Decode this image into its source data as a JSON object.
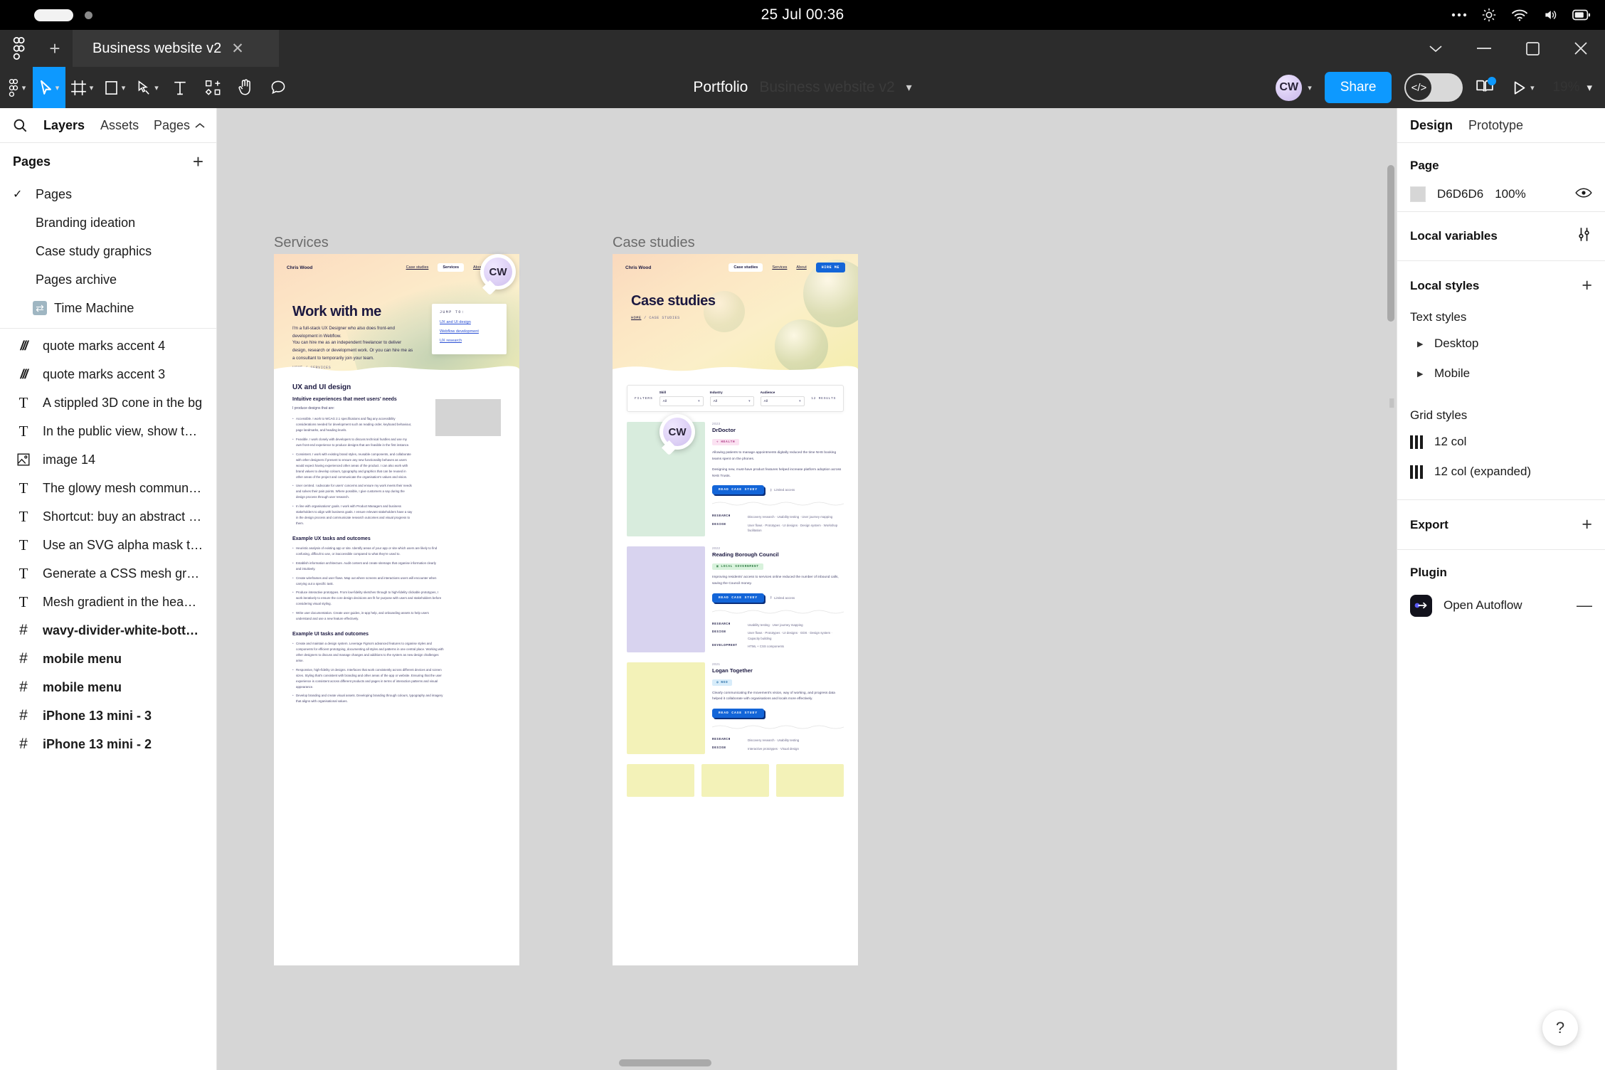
{
  "os": {
    "time": "25 Jul 00:36"
  },
  "tabstrip": {
    "file_tab": "Business website v2",
    "new_tab_label": "+",
    "close_label": "✕"
  },
  "toolbar": {
    "breadcrumb_team": "Portfolio",
    "breadcrumb_file": "Business website v2",
    "avatar_initials": "CW",
    "share_label": "Share",
    "dev_mode_glyph": "</>",
    "zoom_level": "19%"
  },
  "left_panel": {
    "tabs": [
      {
        "label": "Layers",
        "active": true
      },
      {
        "label": "Assets",
        "active": false
      }
    ],
    "pages_toggle": "Pages",
    "pages_header": "Pages",
    "add_page_label": "+",
    "pages": [
      {
        "label": "Pages",
        "selected": true,
        "icon": "none"
      },
      {
        "label": "Branding ideation",
        "selected": false,
        "icon": "none"
      },
      {
        "label": "Case study graphics",
        "selected": false,
        "icon": "none"
      },
      {
        "label": "Pages archive",
        "selected": false,
        "icon": "none"
      },
      {
        "label": "Time Machine",
        "selected": false,
        "icon": "time-machine-emoji"
      }
    ],
    "layers": [
      {
        "label": "quote marks accent 4",
        "icon": "slant",
        "bold": false
      },
      {
        "label": "quote marks accent 3",
        "icon": "slant",
        "bold": false
      },
      {
        "label": "A stippled 3D cone in the bg",
        "icon": "text",
        "bold": false
      },
      {
        "label": "In the public view, show the graph…",
        "icon": "text",
        "bold": false
      },
      {
        "label": "image 14",
        "icon": "image",
        "bold": false
      },
      {
        "label": "The glowy mesh communicates ho…",
        "icon": "text",
        "bold": false
      },
      {
        "label": "Shortcut: buy an abstract Blender …",
        "icon": "text",
        "bold": false
      },
      {
        "label": "Use an SVG alpha mask to make t…",
        "icon": "text",
        "bold": false
      },
      {
        "label": "Generate a CSS mesh gradient:  ht…",
        "icon": "text",
        "bold": false
      },
      {
        "label": "Mesh gradient in the header using …",
        "icon": "text",
        "bold": false
      },
      {
        "label": "wavy-divider-white-bottom",
        "icon": "frame",
        "bold": true
      },
      {
        "label": "mobile menu",
        "icon": "frame",
        "bold": true
      },
      {
        "label": "mobile menu",
        "icon": "frame",
        "bold": true
      },
      {
        "label": "iPhone 13 mini - 3",
        "icon": "frame",
        "bold": true
      },
      {
        "label": "iPhone 13 mini - 2",
        "icon": "frame",
        "bold": true
      }
    ]
  },
  "right_panel": {
    "tabs": [
      {
        "label": "Design",
        "active": true
      },
      {
        "label": "Prototype",
        "active": false
      }
    ],
    "page_section": {
      "title": "Page",
      "fill_hex": "D6D6D6",
      "fill_opacity": "100%"
    },
    "local_variables": {
      "title": "Local variables"
    },
    "local_styles": {
      "title": "Local styles",
      "add_label": "+"
    },
    "text_styles": {
      "title": "Text styles",
      "items": [
        {
          "label": "Desktop"
        },
        {
          "label": "Mobile"
        }
      ]
    },
    "grid_styles": {
      "title": "Grid styles",
      "items": [
        {
          "label": "12 col"
        },
        {
          "label": "12 col (expanded)"
        }
      ]
    },
    "export": {
      "title": "Export",
      "add_label": "+"
    },
    "plugin": {
      "title": "Plugin",
      "items": [
        {
          "label": "Open Autoflow",
          "collapse_label": "—"
        }
      ]
    }
  },
  "canvas": {
    "background": "#D6D6D6",
    "frames": [
      {
        "label": "Services"
      },
      {
        "label": "Case studies"
      }
    ],
    "collaborator_cursors": [
      {
        "initials": "CW"
      },
      {
        "initials": "CW"
      }
    ],
    "services_page": {
      "brand": "Chris Wood",
      "nav": [
        "Case studies",
        "Services",
        "About"
      ],
      "nav_active": "Services",
      "h1": "Work with me",
      "p1": "I'm a full-stack UX Designer who also does front-end development in Webflow.",
      "p2": "You can hire me as an independent freelancer to deliver design, research or development work. Or you can hire me as a consultant to temporarily join your team.",
      "breadcrumb_home": "HOME",
      "breadcrumb_sep": "/",
      "breadcrumb_current": "SERVICES",
      "jump_card": {
        "title": "JUMP TO:",
        "links": [
          "UX and UI design",
          "Webflow development",
          "UX research"
        ]
      },
      "section1_title": "UX and UI design",
      "section1_sub": "Intuitive experiences that meet users' needs",
      "section1_lead": "I produce designs that are:",
      "section1_bullets": [
        "Accessible. I work to WCAG 2.1 specifications and flag any accessibility considerations needed for development such as reading order, keyboard behaviour, page landmarks, and heading levels.",
        "Feasible. I work closely with developers to discuss technical hurdles and use my own front-end experience to produce designs that are feasible in the first instance.",
        "Consistent. I work with existing brand styles, reusable components, and collaborate with other designers if present to ensure any new functionality behaves as users would expect having experienced other areas of the product. I can also work with brand values to develop colours, typography and graphics that can be reused in other areas of the project and communicate the organisation's values and vision.",
        "User centred. I advocate for users' concerns and ensure my work meets their needs and solves their pain points. Where possible, I give customers a say during the design process through user research.",
        "In line with organisations' goals. I work with Product Managers and business stakeholders to align with business goals. I ensure relevant stakeholders have a say in the design process and communicate research outcomes and visual progress to them."
      ],
      "section2_title": "Example UX tasks and outcomes",
      "section2_bullets": [
        "Heuristic analysis of existing app or site. Identify areas of your app or site which users are likely to find confusing, difficult to use, or inaccessible compared to what they're used to.",
        "Establish information architecture. Audit content and create sitemaps that organise information clearly and intuitively.",
        "Create wireframes and user flows. Map out where screens and interactions users will encounter when carrying out a specific task.",
        "Produce interactive prototypes. From low-fidelity sketches through to high-fidelity clickable prototypes, I work iteratively to ensure the core design decisions are fit for purpose with users and stakeholders before considering visual styling.",
        "Write user documentation. Create user guides, in-app help, and onboarding assets to help users understand and use a new feature effectively."
      ],
      "section3_title": "Example UI tasks and outcomes",
      "section3_bullets": [
        "Create and maintain a design system. Leverage Figma's advanced features to organise styles and components for efficient prototyping, documenting all styles and patterns in one central place. Working with other designers to discuss and manage changes and additions to the system as new design challenges arise.",
        "Responsive, high-fidelity UI designs. Interfaces that work consistently across different devices and screen sizes. Styling that's consistent with branding and other areas of the app or website. Ensuring that the user experience is consistent across different products and pages in terms of interaction patterns and visual appearance.",
        "Develop branding and create visual assets. Developing branding through colours, typography and imagery that aligns with organisational values."
      ]
    },
    "case_studies_page": {
      "brand": "Chris Wood",
      "nav": [
        "Case studies",
        "Services",
        "About"
      ],
      "nav_active": "Case studies",
      "hire_button": "HIRE ME",
      "h1": "Case studies",
      "breadcrumb_home": "HOME",
      "breadcrumb_sep": "/",
      "breadcrumb_current": "CASE STUDIES",
      "filters": {
        "label": "FILTERS",
        "fields": [
          {
            "label": "Skill",
            "value": "All"
          },
          {
            "label": "Industry",
            "value": "All"
          },
          {
            "label": "Audience",
            "value": "All"
          }
        ],
        "results": "12 RESULTS"
      },
      "cards": [
        {
          "year": "2023",
          "title": "DrDoctor",
          "tag": "HEALTH",
          "tag_kind": "health",
          "paragraphs": [
            "Allowing patients to manage appointments digitally reduced the time NHS booking teams spent on the phones.",
            "Designing new, must-have product features helped increase platform adoption across NHS Trusts."
          ],
          "button": "READ CASE STUDY",
          "access": "Limited access",
          "meta": [
            {
              "key": "RESEARCH",
              "value": "Discovery research · Usability testing · User journey mapping"
            },
            {
              "key": "DESIGN",
              "value": "User flows · Prototypes · UI designs · Design system · Workshop facilitation"
            }
          ],
          "thumb_color": "green"
        },
        {
          "year": "2022",
          "title": "Reading Borough Council",
          "tag": "LOCAL GOVERNMENT",
          "tag_kind": "gov",
          "paragraphs": [
            "Improving residents' access to services online reduced the number of inbound calls, saving the Council money."
          ],
          "button": "READ CASE STUDY",
          "access": "Limited access",
          "meta": [
            {
              "key": "RESEARCH",
              "value": "Usability testing · User journey mapping"
            },
            {
              "key": "DESIGN",
              "value": "User flows · Prototypes · UI designs · GDS · Design system · Capacity building"
            },
            {
              "key": "DEVELOPMENT",
              "value": "HTML + CSS components"
            }
          ],
          "thumb_color": "purple"
        },
        {
          "year": "2021",
          "title": "Logan Together",
          "tag": "NGO",
          "tag_kind": "ngo",
          "paragraphs": [
            "Clearly communicating the movement's vision, way of working, and progress data helped it collaborate with organisations and locals more effectively."
          ],
          "button": "READ CASE STUDY",
          "access": "",
          "meta": [
            {
              "key": "RESEARCH",
              "value": "Discovery research · Usability testing"
            },
            {
              "key": "DESIGN",
              "value": "Interactive prototypes · Visual design"
            }
          ],
          "thumb_color": "yellow"
        }
      ]
    }
  },
  "help": {
    "label": "?"
  }
}
